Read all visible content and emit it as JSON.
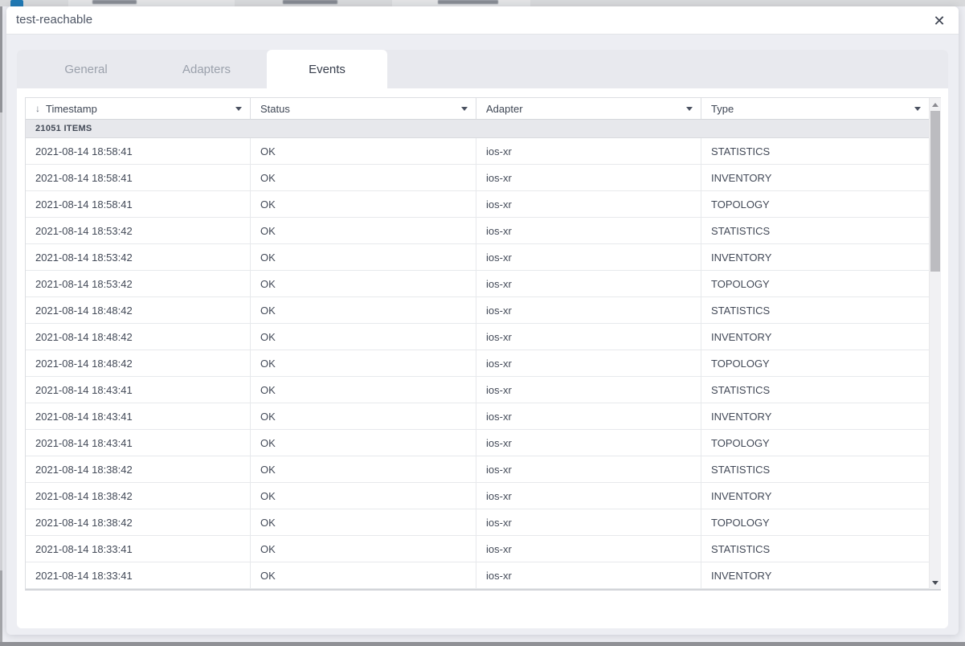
{
  "window": {
    "title": "test-reachable"
  },
  "icons": {
    "close": "✕",
    "sort_desc": "↓",
    "column_menu": "caret-down",
    "scroll_up": "triangle-up",
    "scroll_down": "triangle-down"
  },
  "tabs": [
    {
      "label": "General",
      "active": false
    },
    {
      "label": "Adapters",
      "active": false
    },
    {
      "label": "Events",
      "active": true
    }
  ],
  "table": {
    "summary": "21051 ITEMS",
    "columns": [
      {
        "label": "Timestamp",
        "sorted": "desc"
      },
      {
        "label": "Status"
      },
      {
        "label": "Adapter"
      },
      {
        "label": "Type"
      }
    ],
    "rows": [
      {
        "timestamp": "2021-08-14 18:58:41",
        "status": "OK",
        "adapter": "ios-xr",
        "type": "STATISTICS"
      },
      {
        "timestamp": "2021-08-14 18:58:41",
        "status": "OK",
        "adapter": "ios-xr",
        "type": "INVENTORY"
      },
      {
        "timestamp": "2021-08-14 18:58:41",
        "status": "OK",
        "adapter": "ios-xr",
        "type": "TOPOLOGY"
      },
      {
        "timestamp": "2021-08-14 18:53:42",
        "status": "OK",
        "adapter": "ios-xr",
        "type": "STATISTICS"
      },
      {
        "timestamp": "2021-08-14 18:53:42",
        "status": "OK",
        "adapter": "ios-xr",
        "type": "INVENTORY"
      },
      {
        "timestamp": "2021-08-14 18:53:42",
        "status": "OK",
        "adapter": "ios-xr",
        "type": "TOPOLOGY"
      },
      {
        "timestamp": "2021-08-14 18:48:42",
        "status": "OK",
        "adapter": "ios-xr",
        "type": "STATISTICS"
      },
      {
        "timestamp": "2021-08-14 18:48:42",
        "status": "OK",
        "adapter": "ios-xr",
        "type": "INVENTORY"
      },
      {
        "timestamp": "2021-08-14 18:48:42",
        "status": "OK",
        "adapter": "ios-xr",
        "type": "TOPOLOGY"
      },
      {
        "timestamp": "2021-08-14 18:43:41",
        "status": "OK",
        "adapter": "ios-xr",
        "type": "STATISTICS"
      },
      {
        "timestamp": "2021-08-14 18:43:41",
        "status": "OK",
        "adapter": "ios-xr",
        "type": "INVENTORY"
      },
      {
        "timestamp": "2021-08-14 18:43:41",
        "status": "OK",
        "adapter": "ios-xr",
        "type": "TOPOLOGY"
      },
      {
        "timestamp": "2021-08-14 18:38:42",
        "status": "OK",
        "adapter": "ios-xr",
        "type": "STATISTICS"
      },
      {
        "timestamp": "2021-08-14 18:38:42",
        "status": "OK",
        "adapter": "ios-xr",
        "type": "INVENTORY"
      },
      {
        "timestamp": "2021-08-14 18:38:42",
        "status": "OK",
        "adapter": "ios-xr",
        "type": "TOPOLOGY"
      },
      {
        "timestamp": "2021-08-14 18:33:41",
        "status": "OK",
        "adapter": "ios-xr",
        "type": "STATISTICS"
      },
      {
        "timestamp": "2021-08-14 18:33:41",
        "status": "OK",
        "adapter": "ios-xr",
        "type": "INVENTORY"
      }
    ]
  },
  "colors": {
    "backdrop": "#edeef3",
    "accent_blue": "#2079b4",
    "tab_strip": "#e8e9ee",
    "header_text": "#3f4755",
    "cell_text": "#424957",
    "items_row_bg": "#e7e8ec",
    "row_border": "#e7e9ec",
    "scroll_thumb": "#bcbcc0"
  }
}
